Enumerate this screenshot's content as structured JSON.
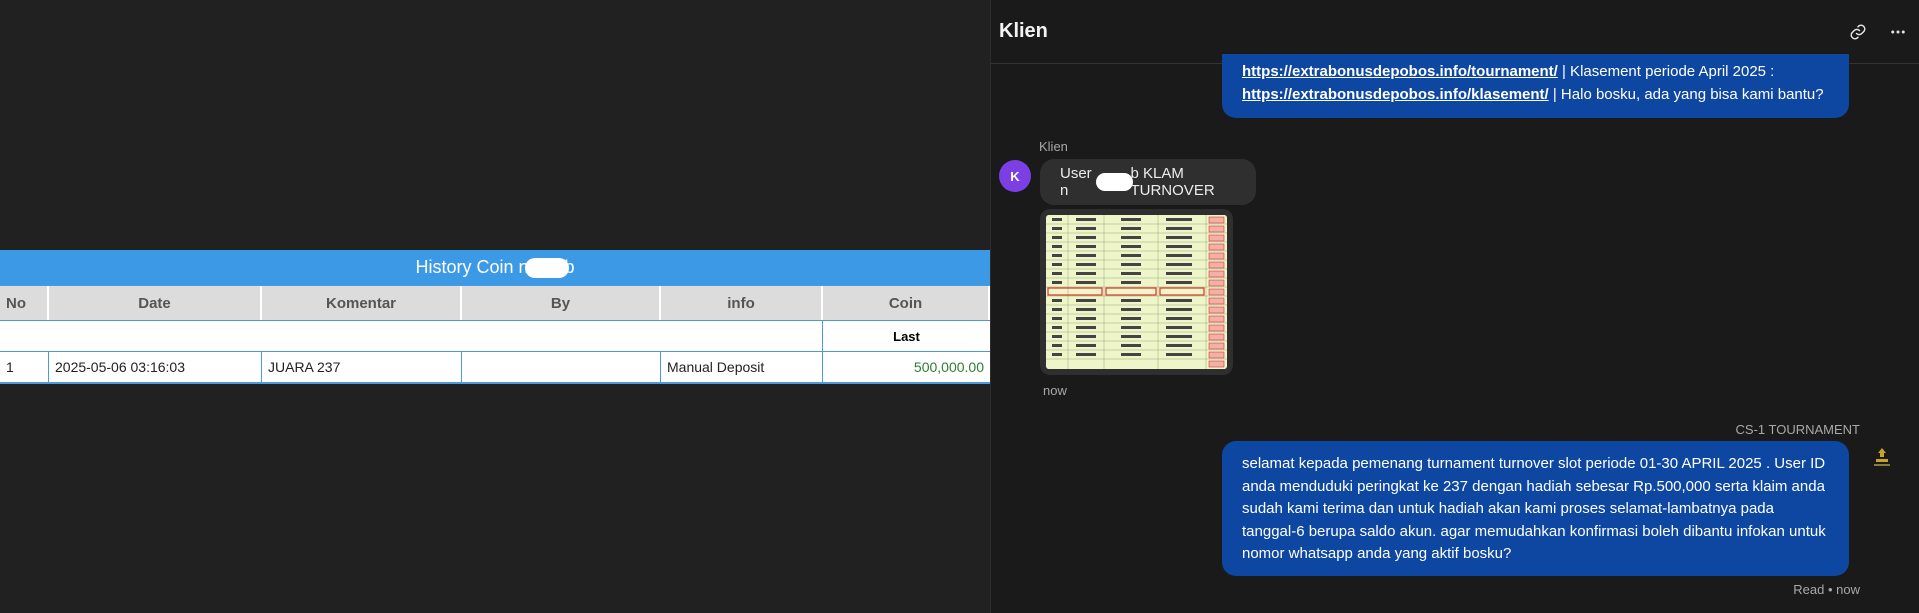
{
  "history": {
    "title_pre": "History Coin n",
    "title_post": "b",
    "columns": [
      "No",
      "Date",
      "Komentar",
      "By",
      "info",
      "Coin"
    ],
    "sub_label": "Last",
    "row": {
      "no": "1",
      "date": "2025-05-06 03:16:03",
      "komentar": "JUARA 237",
      "by": "",
      "info": "Manual Deposit",
      "coin": "500,000.00"
    }
  },
  "chat": {
    "title": "Klien",
    "icons": [
      "link-icon",
      "more-icon"
    ],
    "top_message": {
      "link1": "https://extrabonusdepobos.info/tournament/",
      "text1": " | Klasement periode April 2025 :",
      "link2": "https://extrabonusdepobos.info/klasement/",
      "text2": " | Halo bosku, ada yang bisa kami bantu?"
    },
    "incoming": {
      "sender": "Klien",
      "avatar_letter": "K",
      "text_pre": "User n",
      "text_post": "b KLAM TURNOVER",
      "time": "now"
    },
    "outgoing": {
      "sender": "CS-1 TOURNAMENT",
      "text": "selamat kepada pemenang turnament turnover slot periode 01-30 APRIL 2025 . User ID anda menduduki peringkat ke 237 dengan hadiah sebesar Rp.500,000 serta klaim anda sudah kami terima dan untuk hadiah akan kami proses selamat-lambatnya pada tanggal-6 berupa saldo akun. agar memudahkan konfirmasi boleh dibantu infokan untuk nomor whatsapp anda yang aktif bosku?",
      "status": "Read • now"
    }
  },
  "colors": {
    "table_header": "#3b99e6",
    "outgoing_bubble": "#0e47a1",
    "incoming_bubble": "#2f2f2f",
    "avatar": "#7b3fe4",
    "coin": "#2e7d32"
  }
}
